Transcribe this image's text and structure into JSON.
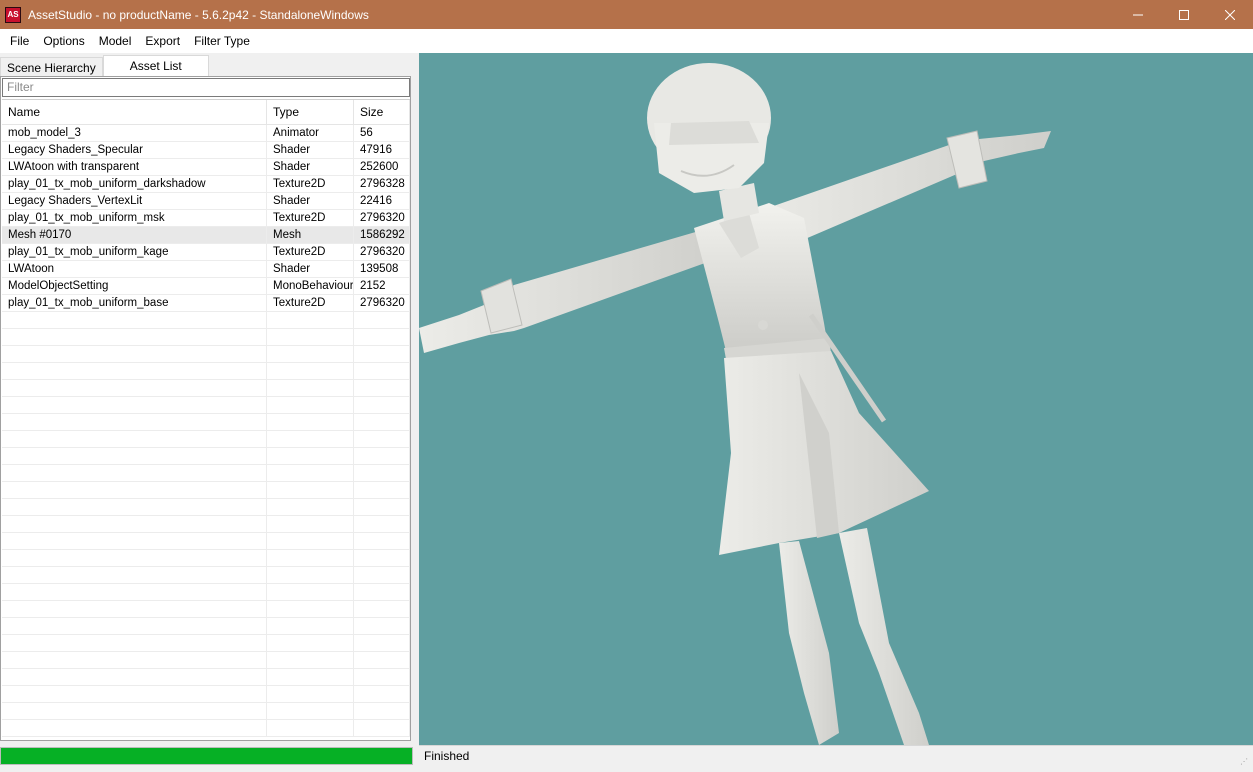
{
  "window": {
    "icon": "AS",
    "title": "AssetStudio - no productName - 5.6.2p42 - StandaloneWindows",
    "controls": {
      "minimize": "—",
      "maximize": "☐",
      "close": "✕"
    }
  },
  "menu": [
    "File",
    "Options",
    "Model",
    "Export",
    "Filter Type"
  ],
  "tabs": [
    {
      "label": "Scene Hierarchy",
      "active": false
    },
    {
      "label": "Asset List",
      "active": true
    }
  ],
  "filter": {
    "placeholder": "Filter"
  },
  "asset_list": {
    "columns": [
      "Name",
      "Type",
      "Size"
    ],
    "rows": [
      {
        "name": "mob_model_3",
        "type": "Animator",
        "size": "56"
      },
      {
        "name": "Legacy Shaders_Specular",
        "type": "Shader",
        "size": "47916"
      },
      {
        "name": "LWAtoon with transparent",
        "type": "Shader",
        "size": "252600"
      },
      {
        "name": "play_01_tx_mob_uniform_darkshadow",
        "type": "Texture2D",
        "size": "2796328"
      },
      {
        "name": "Legacy Shaders_VertexLit",
        "type": "Shader",
        "size": "22416"
      },
      {
        "name": "play_01_tx_mob_uniform_msk",
        "type": "Texture2D",
        "size": "2796320"
      },
      {
        "name": "Mesh #0170",
        "type": "Mesh",
        "size": "1586292",
        "selected": true
      },
      {
        "name": "play_01_tx_mob_uniform_kage",
        "type": "Texture2D",
        "size": "2796320"
      },
      {
        "name": "LWAtoon",
        "type": "Shader",
        "size": "139508"
      },
      {
        "name": "ModelObjectSetting",
        "type": "MonoBehaviour",
        "size": "2152"
      },
      {
        "name": "play_01_tx_mob_uniform_base",
        "type": "Texture2D",
        "size": "2796320"
      }
    ]
  },
  "progress": {
    "fraction": 1.0,
    "color": "#06b025"
  },
  "viewport": {
    "background": "#5f9ea0",
    "model_color": "#e4e4e0"
  },
  "status": {
    "text": "Finished"
  }
}
